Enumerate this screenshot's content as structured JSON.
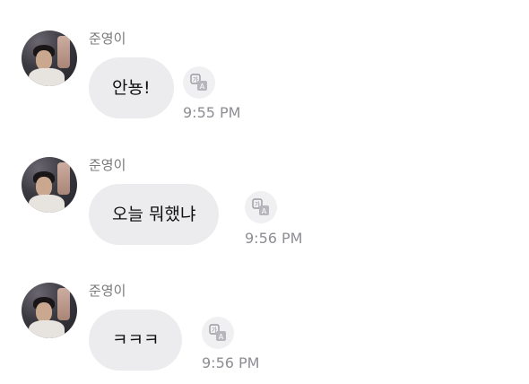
{
  "messages": [
    {
      "sender": "준영이",
      "text": "안뇽!",
      "time": "9:55 PM",
      "avatar_icon": "profile-photo",
      "translate_icon": "translate-icon"
    },
    {
      "sender": "준영이",
      "text": "오늘 뭐했냐",
      "time": "9:56 PM",
      "avatar_icon": "profile-photo",
      "translate_icon": "translate-icon"
    },
    {
      "sender": "준영이",
      "text": "ㅋㅋㅋ",
      "time": "9:56 PM",
      "avatar_icon": "profile-photo",
      "translate_icon": "translate-icon"
    }
  ],
  "colors": {
    "bubble": "#ececee",
    "time": "#8d8d93",
    "sender": "#7a7a7a"
  }
}
